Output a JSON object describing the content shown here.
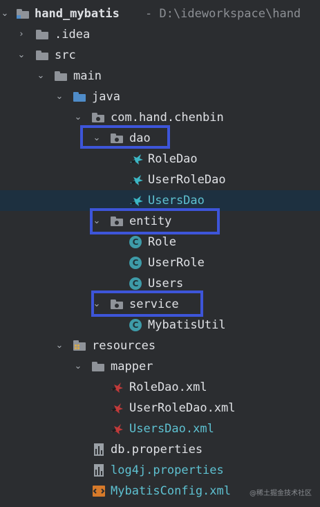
{
  "project": {
    "name": "hand_mybatis",
    "path": "- D:\\ideworkspace\\hand"
  },
  "tree": {
    "idea": ".idea",
    "src": "src",
    "main": "main",
    "java": "java",
    "package": "com.hand.chenbin",
    "dao": "dao",
    "role_dao": "RoleDao",
    "user_role_dao": "UserRoleDao",
    "users_dao": "UsersDao",
    "entity": "entity",
    "role": "Role",
    "user_role": "UserRole",
    "users": "Users",
    "service": "service",
    "mybatis_util": "MybatisUtil",
    "resources": "resources",
    "mapper": "mapper",
    "role_dao_xml": "RoleDao.xml",
    "user_role_dao_xml": "UserRoleDao.xml",
    "users_dao_xml": "UsersDao.xml",
    "db_properties": "db.properties",
    "log4j_properties": "log4j.properties",
    "mybatis_config": "MybatisConfig.xml"
  },
  "icons": {
    "expanded_arrow": "chevron-down-icon",
    "collapsed_arrow": "chevron-right-icon",
    "folder": "folder-icon",
    "package": "package-icon",
    "class": "class-icon",
    "mapper_interface": "mybatis-interface-icon",
    "xml": "xml-file-icon",
    "properties": "properties-file-icon"
  },
  "colors": {
    "background": "#2b2d30",
    "selected_row": "#1d3040",
    "highlight_box": "#3d55d9",
    "vcs_new_text": "#5ec1d1",
    "source_folder": "#4f8cc9"
  },
  "watermark": "@稀土掘金技术社区"
}
